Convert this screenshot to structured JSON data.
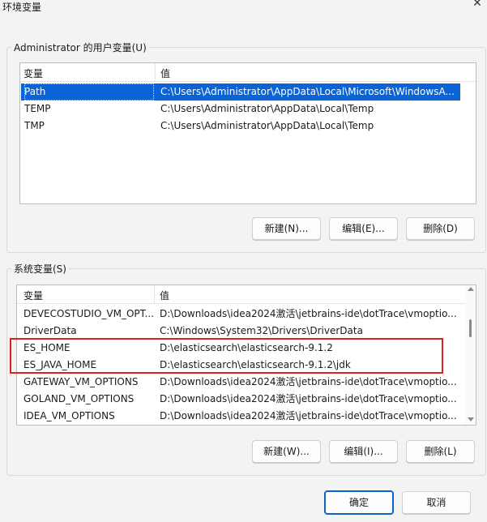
{
  "window": {
    "title": "环境变量",
    "close_icon": "close-icon"
  },
  "user_vars": {
    "group_label": "Administrator 的用户变量(U)",
    "headers": [
      "变量",
      "值"
    ],
    "rows": [
      {
        "name": "Path",
        "value": "C:\\Users\\Administrator\\AppData\\Local\\Microsoft\\WindowsA...",
        "selected": true
      },
      {
        "name": "TEMP",
        "value": "C:\\Users\\Administrator\\AppData\\Local\\Temp"
      },
      {
        "name": "TMP",
        "value": "C:\\Users\\Administrator\\AppData\\Local\\Temp"
      }
    ],
    "new_label": "新建(N)...",
    "edit_label": "编辑(E)...",
    "delete_label": "删除(D)"
  },
  "system_vars": {
    "group_label": "系统变量(S)",
    "headers": [
      "变量",
      "值"
    ],
    "rows": [
      {
        "name": "DEVECOSTUDIO_VM_OPT...",
        "value": "D:\\Downloads\\idea2024激活\\jetbrains-ide\\dotTrace\\vmoptio..."
      },
      {
        "name": "DriverData",
        "value": "C:\\Windows\\System32\\Drivers\\DriverData"
      },
      {
        "name": "ES_HOME",
        "value": "D:\\elasticsearch\\elasticsearch-9.1.2"
      },
      {
        "name": "ES_JAVA_HOME",
        "value": "D:\\elasticsearch\\elasticsearch-9.1.2\\jdk"
      },
      {
        "name": "GATEWAY_VM_OPTIONS",
        "value": "D:\\Downloads\\idea2024激活\\jetbrains-ide\\dotTrace\\vmoptio..."
      },
      {
        "name": "GOLAND_VM_OPTIONS",
        "value": "D:\\Downloads\\idea2024激活\\jetbrains-ide\\dotTrace\\vmoptio..."
      },
      {
        "name": "IDEA_VM_OPTIONS",
        "value": "D:\\Downloads\\idea2024激活\\jetbrains-ide\\dotTrace\\vmoptio..."
      }
    ],
    "new_label": "新建(W)...",
    "edit_label": "编辑(I)...",
    "delete_label": "删除(L)"
  },
  "footer": {
    "ok_label": "确定",
    "cancel_label": "取消"
  },
  "colors": {
    "selection": "#0a64d8",
    "highlight_box": "#e02020"
  }
}
